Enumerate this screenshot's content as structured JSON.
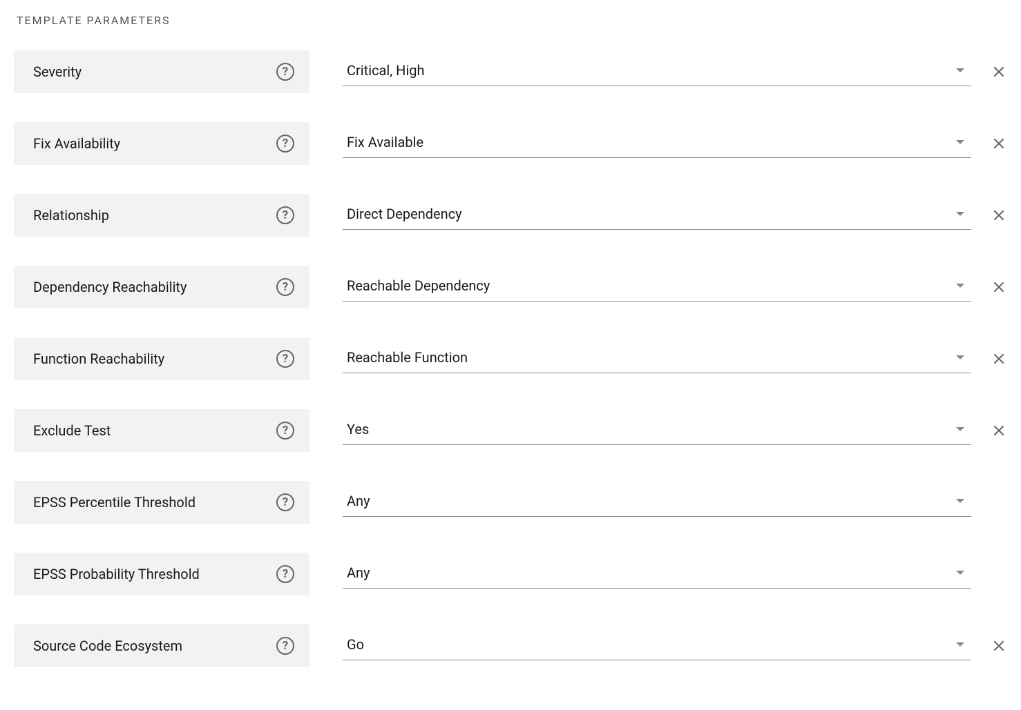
{
  "section_title": "TEMPLATE PARAMETERS",
  "params": [
    {
      "label": "Severity",
      "value": "Critical, High",
      "clearable": true
    },
    {
      "label": "Fix Availability",
      "value": "Fix Available",
      "clearable": true
    },
    {
      "label": "Relationship",
      "value": "Direct Dependency",
      "clearable": true
    },
    {
      "label": "Dependency Reachability",
      "value": "Reachable Dependency",
      "clearable": true
    },
    {
      "label": "Function Reachability",
      "value": "Reachable Function",
      "clearable": true
    },
    {
      "label": "Exclude Test",
      "value": "Yes",
      "clearable": true
    },
    {
      "label": "EPSS Percentile Threshold",
      "value": "Any",
      "clearable": false
    },
    {
      "label": "EPSS Probability Threshold",
      "value": "Any",
      "clearable": false
    },
    {
      "label": "Source Code Ecosystem",
      "value": "Go",
      "clearable": true
    }
  ]
}
